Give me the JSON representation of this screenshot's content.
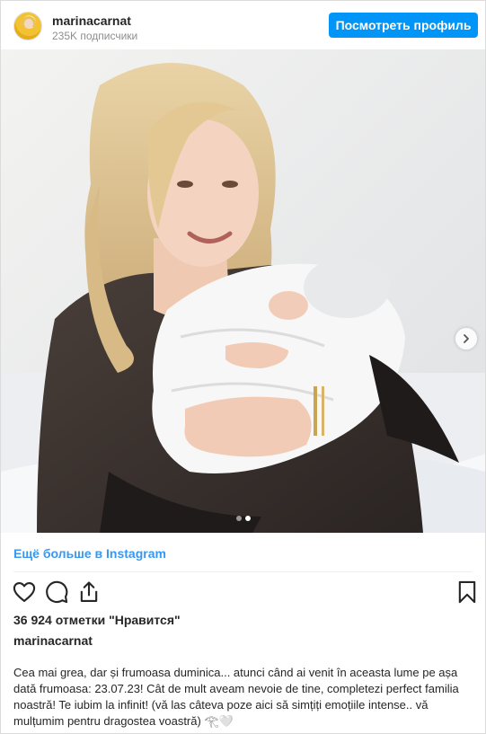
{
  "header": {
    "username": "marinacarnat",
    "followers": "235K подписчики",
    "profile_button": "Посмотреть профиль"
  },
  "photo": {
    "carousel": {
      "count": 2,
      "active_index": 1
    }
  },
  "more_link": "Ещё больше в Instagram",
  "actions": {
    "like_icon": "heart-icon",
    "comment_icon": "comment-icon",
    "share_icon": "share-icon",
    "save_icon": "bookmark-icon"
  },
  "likes_text": "36 924 отметки \"Нравится\"",
  "caption": {
    "username": "marinacarnat",
    "text": "Cea mai grea, dar și frumoasa duminica... atunci când ai venit în aceasta lume pe așa dată frumoasa: 23.07.23! Cât de mult aveam nevoie de tine, completezi perfect familia noastră! Te iubim la infinit! (vă las câteva poze aici să simțiți emoțiile intense.. vă mulțumim pentru dragostea voastră) 𓂀🤍"
  },
  "colors": {
    "accent": "#0095f6",
    "link": "#3897f0",
    "text": "#262626",
    "muted": "#8e8e8e"
  }
}
